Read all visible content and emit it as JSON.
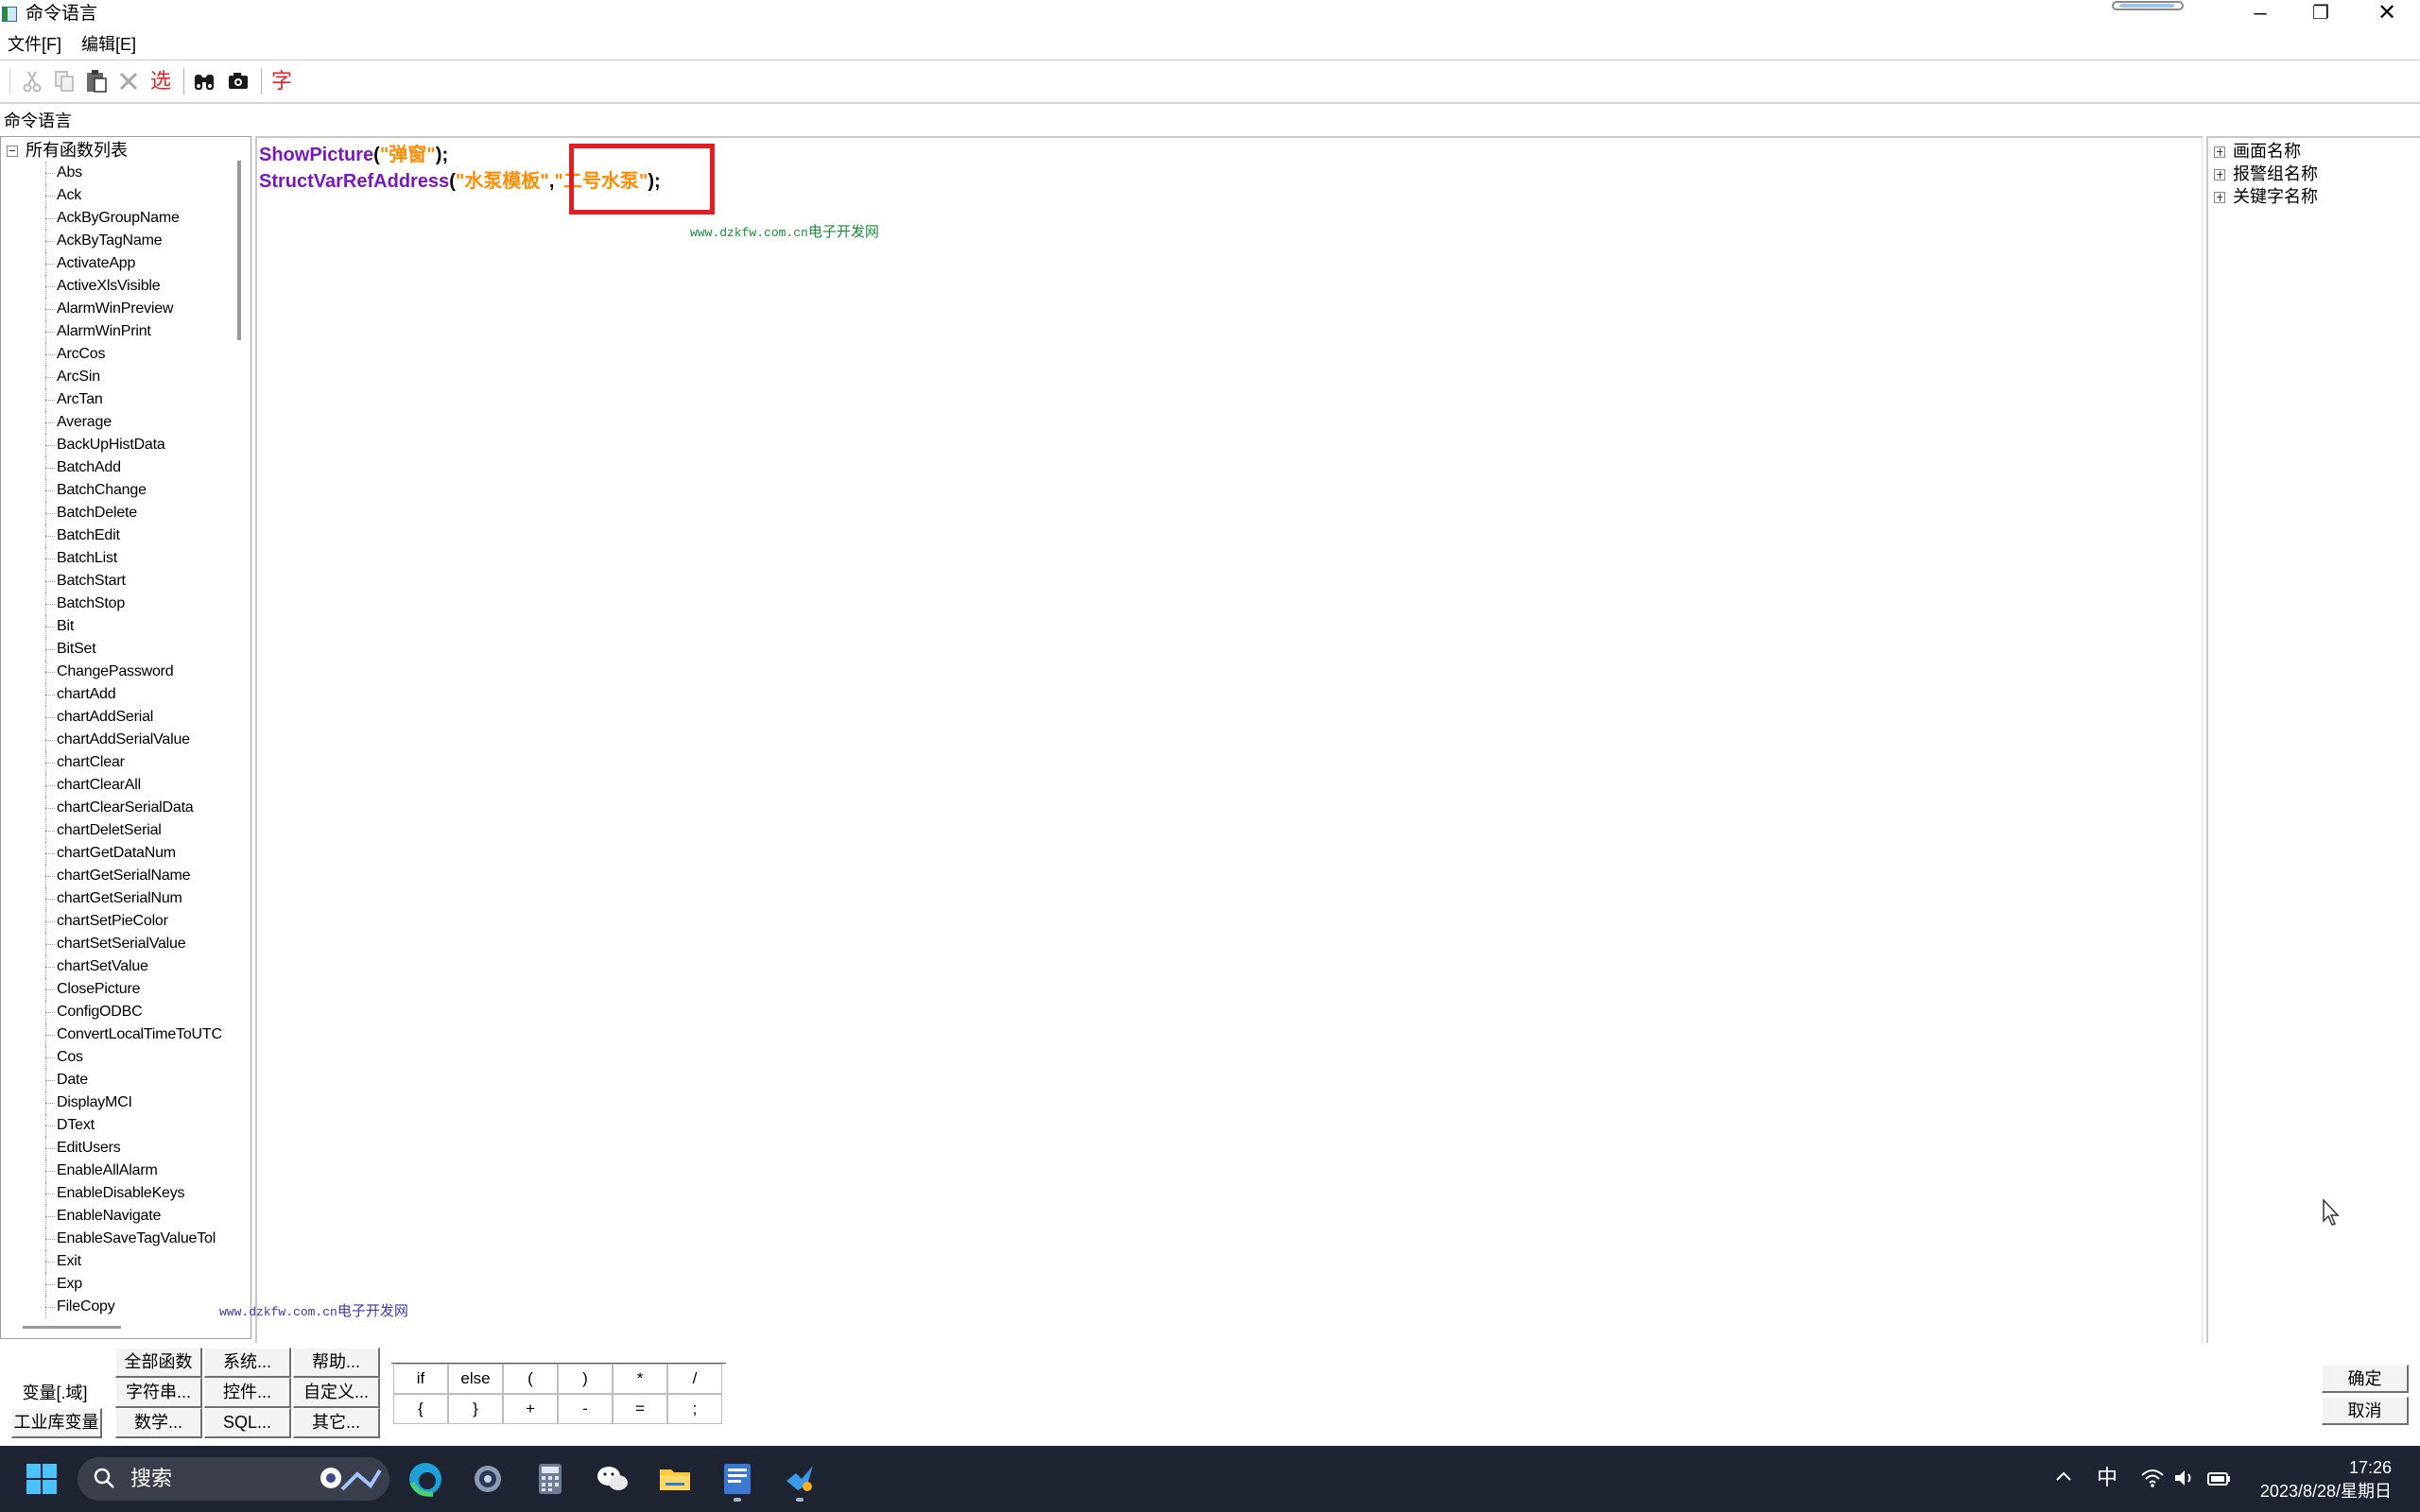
{
  "window": {
    "title": "命令语言",
    "controls": {
      "minimize": "–",
      "restore": "❐",
      "close": "✕"
    }
  },
  "menu": [
    "文件[F]",
    "编辑[E]"
  ],
  "toolbar": {
    "items": [
      "cut-icon",
      "copy-icon",
      "paste-icon",
      "delete-icon",
      "选",
      "binoculars-icon",
      "camera-icon",
      "字"
    ],
    "select_label": "选",
    "font_label": "字"
  },
  "panel_caption": "命令语言",
  "function_tree": {
    "root": "所有函数列表",
    "items": [
      "Abs",
      "Ack",
      "AckByGroupName",
      "AckByTagName",
      "ActivateApp",
      "ActiveXlsVisible",
      "AlarmWinPreview",
      "AlarmWinPrint",
      "ArcCos",
      "ArcSin",
      "ArcTan",
      "Average",
      "BackUpHistData",
      "BatchAdd",
      "BatchChange",
      "BatchDelete",
      "BatchEdit",
      "BatchList",
      "BatchStart",
      "BatchStop",
      "Bit",
      "BitSet",
      "ChangePassword",
      "chartAdd",
      "chartAddSerial",
      "chartAddSerialValue",
      "chartClear",
      "chartClearAll",
      "chartClearSerialData",
      "chartDeletSerial",
      "chartGetDataNum",
      "chartGetSerialName",
      "chartGetSerialNum",
      "chartSetPieColor",
      "chartSetSerialValue",
      "chartSetValue",
      "ClosePicture",
      "ConfigODBC",
      "ConvertLocalTimeToUTC",
      "Cos",
      "Date",
      "DisplayMCI",
      "DText",
      "EditUsers",
      "EnableAllAlarm",
      "EnableDisableKeys",
      "EnableNavigate",
      "EnableSaveTagValueTol",
      "Exit",
      "Exp",
      "FileCopy"
    ]
  },
  "code": {
    "line1": {
      "fn": "ShowPicture",
      "open": "(",
      "arg1": "\"弹窗\"",
      "close": ");"
    },
    "line2": {
      "fn": "StructVarRefAddress",
      "open": "(",
      "arg1": "\"水泵模板\"",
      "sep": ",",
      "arg2": "\"二号水泵\"",
      "close": ");"
    }
  },
  "watermarks": {
    "editor": {
      "url": "www.dzkfw.com.cn",
      "name": "电子开发网"
    },
    "tree": {
      "url": "www.dzkfw.com.cn",
      "name": "电子开发网"
    }
  },
  "right_tree": [
    "画面名称",
    "报警组名称",
    "关键字名称"
  ],
  "bottom_buttons": {
    "all_functions": "全部函数",
    "system": "系统...",
    "help": "帮助...",
    "variable_field": "变量[.域]",
    "string": "字符串...",
    "control": "控件...",
    "custom": "自定义...",
    "industrial_db_var": "工业库变量",
    "math": "数学...",
    "sql": "SQL...",
    "other": "其它..."
  },
  "operators": [
    "if",
    "else",
    "(",
    ")",
    "*",
    "/",
    "{",
    "}",
    "+",
    "-",
    "=",
    ";"
  ],
  "dialog_buttons": {
    "ok": "确定",
    "cancel": "取消"
  },
  "taskbar": {
    "search_placeholder": "搜索",
    "ime": "中",
    "time": "17:26",
    "date": "2023/8/28/星期日",
    "apps": [
      "edge-icon",
      "settings-icon",
      "calculator-icon",
      "wechat-icon",
      "file-explorer-icon",
      "kingview-icon",
      "bird-app-icon"
    ]
  },
  "colors": {
    "function_name": "#7a18b8",
    "string_literal": "#ff8c00",
    "highlight": "#e41c23",
    "taskbar": "#1f2433"
  }
}
